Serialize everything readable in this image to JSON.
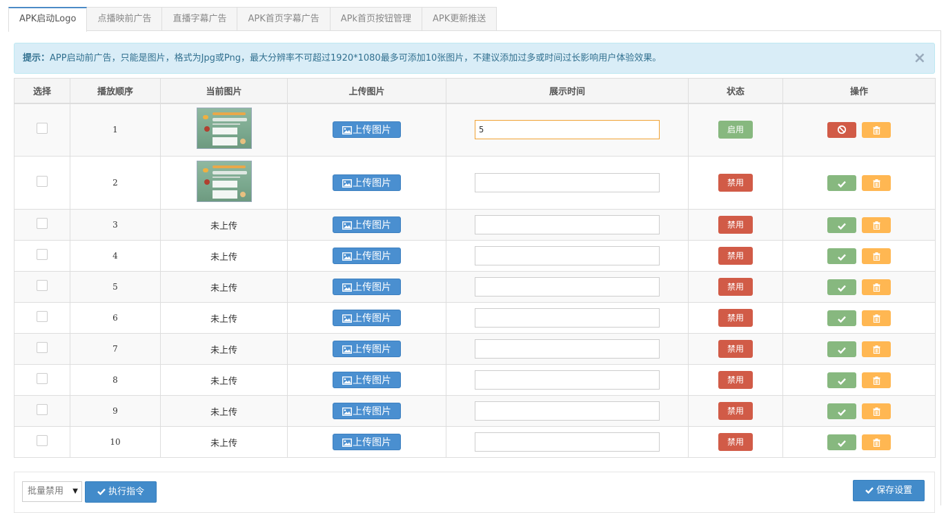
{
  "tabs": [
    {
      "label": "APK启动Logo",
      "active": true
    },
    {
      "label": "点播映前广告",
      "active": false
    },
    {
      "label": "直播字幕广告",
      "active": false
    },
    {
      "label": "APK首页字幕广告",
      "active": false
    },
    {
      "label": "APk首页按钮管理",
      "active": false
    },
    {
      "label": "APK更新推送",
      "active": false
    }
  ],
  "alert": {
    "prefix": "提示：",
    "text": "APP启动前广告，只能是图片，格式为Jpg或Png，最大分辨率不可超过1920*1080最多可添加10张图片，不建议添加过多或时间过长影响用户体验效果。",
    "close": "×"
  },
  "table": {
    "headers": [
      "选择",
      "播放顺序",
      "当前图片",
      "上传图片",
      "展示时间",
      "状态",
      "操作"
    ],
    "upload_label": "上传图片",
    "not_uploaded_label": "未上传",
    "rows": [
      {
        "order": "1",
        "has_image": true,
        "time": "5",
        "status": "启用",
        "enabled": true
      },
      {
        "order": "2",
        "has_image": true,
        "time": "",
        "status": "禁用",
        "enabled": false
      },
      {
        "order": "3",
        "has_image": false,
        "time": "",
        "status": "禁用",
        "enabled": false
      },
      {
        "order": "4",
        "has_image": false,
        "time": "",
        "status": "禁用",
        "enabled": false
      },
      {
        "order": "5",
        "has_image": false,
        "time": "",
        "status": "禁用",
        "enabled": false
      },
      {
        "order": "6",
        "has_image": false,
        "time": "",
        "status": "禁用",
        "enabled": false
      },
      {
        "order": "7",
        "has_image": false,
        "time": "",
        "status": "禁用",
        "enabled": false
      },
      {
        "order": "8",
        "has_image": false,
        "time": "",
        "status": "禁用",
        "enabled": false
      },
      {
        "order": "9",
        "has_image": false,
        "time": "",
        "status": "禁用",
        "enabled": false
      },
      {
        "order": "10",
        "has_image": false,
        "time": "",
        "status": "禁用",
        "enabled": false
      }
    ]
  },
  "footer": {
    "batch_select_value": "批量禁用",
    "exec_label": "执行指令",
    "save_label": "保存设置"
  },
  "colors": {
    "primary": "#428bca",
    "success": "#87b87f",
    "danger": "#d15b47",
    "warning": "#ffb752",
    "alert_bg": "#d9edf7"
  }
}
